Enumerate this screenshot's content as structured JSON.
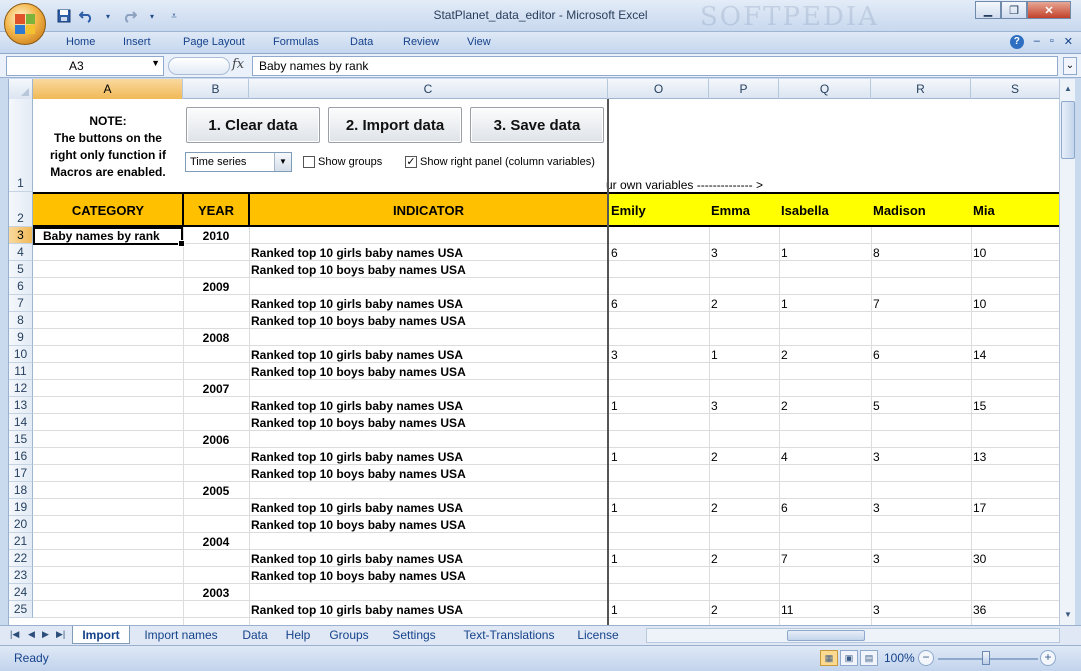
{
  "window": {
    "title": "StatPlanet_data_editor - Microsoft Excel",
    "watermark": "SOFTPEDIA",
    "minimize": "▁",
    "restore": "❐",
    "close": "✕"
  },
  "qat": {
    "save_icon": "save-icon",
    "undo_icon": "undo-icon",
    "redo_icon": "redo-icon",
    "customize_icon": "customize-icon"
  },
  "ribbon": {
    "tabs": [
      "Home",
      "Insert",
      "Page Layout",
      "Formulas",
      "Data",
      "Review",
      "View"
    ],
    "help": "?",
    "min": "–",
    "restore": "▫",
    "close": "✕"
  },
  "formula_bar": {
    "name_box": "A3",
    "fx": "fx",
    "content": "Baby names by rank"
  },
  "columns": {
    "left": [
      "A",
      "B",
      "C"
    ],
    "right": [
      "O",
      "P",
      "Q",
      "R",
      "S"
    ],
    "selected": "A"
  },
  "rows": {
    "numbers": [
      "1",
      "2",
      "3",
      "4",
      "5",
      "6",
      "7",
      "8",
      "9",
      "10",
      "11",
      "12",
      "13",
      "14",
      "15",
      "16",
      "17",
      "18",
      "19",
      "20",
      "21",
      "22",
      "23",
      "24",
      "25"
    ],
    "selected": "3"
  },
  "controls": {
    "note": "NOTE:\nThe buttons on the\nright only function if\nMacros are enabled.",
    "clear_button": "1. Clear data",
    "import_button": "2. Import data",
    "save_button": "3. Save data",
    "series_select": "Time series",
    "show_groups_label": "Show groups",
    "show_groups_checked": false,
    "show_right_panel_label": "Show right panel (column variables)",
    "show_right_panel_checked": true,
    "own_vars_text": "ur own variables  --------------  >"
  },
  "header_row": {
    "category": "CATEGORY",
    "year": "YEAR",
    "indicator": "INDICATOR",
    "names": [
      "Emily",
      "Emma",
      "Isabella",
      "Madison",
      "Mia"
    ]
  },
  "table": {
    "category": "Baby names by rank",
    "girls_label": "Ranked top 10 girls baby names USA",
    "boys_label": "Ranked top 10 boys baby names USA",
    "years": [
      {
        "year": "2010",
        "girls": [
          "6",
          "3",
          "1",
          "8",
          "10"
        ]
      },
      {
        "year": "2009",
        "girls": [
          "6",
          "2",
          "1",
          "7",
          "10"
        ]
      },
      {
        "year": "2008",
        "girls": [
          "3",
          "1",
          "2",
          "6",
          "14"
        ]
      },
      {
        "year": "2007",
        "girls": [
          "1",
          "3",
          "2",
          "5",
          "15"
        ]
      },
      {
        "year": "2006",
        "girls": [
          "1",
          "2",
          "4",
          "3",
          "13"
        ]
      },
      {
        "year": "2005",
        "girls": [
          "1",
          "2",
          "6",
          "3",
          "17"
        ]
      },
      {
        "year": "2004",
        "girls": [
          "1",
          "2",
          "7",
          "3",
          "30"
        ]
      },
      {
        "year": "2003",
        "girls": [
          "1",
          "2",
          "11",
          "3",
          "36"
        ]
      }
    ]
  },
  "sheet_tabs": {
    "tabs": [
      "Import",
      "Import names",
      "Data",
      "Help",
      "Groups",
      "Settings",
      "Text-Translations",
      "License"
    ],
    "active": "Import"
  },
  "status": {
    "text": "Ready",
    "zoom": "100%",
    "zoom_minus": "−",
    "zoom_plus": "+"
  }
}
